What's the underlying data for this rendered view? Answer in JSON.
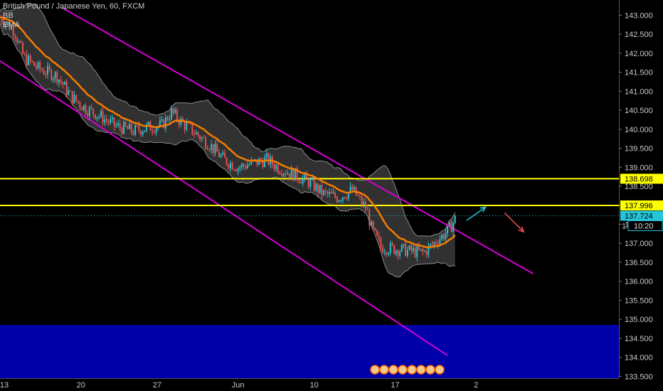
{
  "legend": {
    "symbol": "British Pound / Japanese Yen, 60, FXCM",
    "indicator_1": "BB",
    "indicator_2": "EMA"
  },
  "colors": {
    "background": "#000000",
    "candle_up": "#26c6da",
    "candle_down": "#ef5350",
    "ema": "#f57c00",
    "bb_fill": "#3a3a3a",
    "bb_line": "#8a8a8a",
    "channel": "#d400d4",
    "level": "#ffff00",
    "zone": "#0000a8",
    "price_tag": "#26c6da"
  },
  "chart_data": {
    "type": "candlestick",
    "title": "British Pound / Japanese Yen, 60, FXCM",
    "indicators": [
      "BB",
      "EMA"
    ],
    "ylim": [
      133.45,
      143.4
    ],
    "y_ticks": [
      "133.500",
      "134.000",
      "134.500",
      "135.000",
      "135.500",
      "136.000",
      "136.500",
      "137.000",
      "137.500",
      "138.000",
      "138.500",
      "139.000",
      "139.500",
      "140.000",
      "140.500",
      "141.000",
      "141.500",
      "142.000",
      "142.500",
      "143.000"
    ],
    "x_tick_labels": [
      "13",
      "20",
      "27",
      "Jun",
      "10",
      "17",
      "2"
    ],
    "horizontal_levels": [
      {
        "value": 138.698,
        "label": "138.698"
      },
      {
        "value": 137.996,
        "label": "137.996"
      }
    ],
    "current_price": {
      "value": 137.724,
      "label": "137.724",
      "countdown": "10:20",
      "partial_label": "1"
    },
    "support_zone": {
      "from": 133.45,
      "to": 134.85
    },
    "price_path": [
      {
        "t": 0,
        "p": 142.95
      },
      {
        "t": 3,
        "p": 142.6
      },
      {
        "t": 5,
        "p": 141.9
      },
      {
        "t": 8,
        "p": 141.6
      },
      {
        "t": 12,
        "p": 141.4
      },
      {
        "t": 15,
        "p": 140.85
      },
      {
        "t": 18,
        "p": 140.55
      },
      {
        "t": 21,
        "p": 140.35
      },
      {
        "t": 24,
        "p": 140.1
      },
      {
        "t": 28,
        "p": 139.95
      },
      {
        "t": 31,
        "p": 140.05
      },
      {
        "t": 34,
        "p": 140.1
      },
      {
        "t": 36,
        "p": 140.45
      },
      {
        "t": 38,
        "p": 140.2
      },
      {
        "t": 41,
        "p": 139.9
      },
      {
        "t": 44,
        "p": 139.6
      },
      {
        "t": 47,
        "p": 139.2
      },
      {
        "t": 50,
        "p": 139.0
      },
      {
        "t": 53,
        "p": 139.1
      },
      {
        "t": 56,
        "p": 139.2
      },
      {
        "t": 59,
        "p": 138.95
      },
      {
        "t": 62,
        "p": 138.8
      },
      {
        "t": 65,
        "p": 138.6
      },
      {
        "t": 68,
        "p": 138.3
      },
      {
        "t": 71,
        "p": 138.2
      },
      {
        "t": 74,
        "p": 138.4
      },
      {
        "t": 77,
        "p": 137.9
      },
      {
        "t": 78,
        "p": 137.4
      },
      {
        "t": 80,
        "p": 136.9
      },
      {
        "t": 83,
        "p": 136.85
      },
      {
        "t": 86,
        "p": 136.8
      },
      {
        "t": 89,
        "p": 136.75
      },
      {
        "t": 92,
        "p": 137.1
      },
      {
        "t": 94,
        "p": 137.3
      },
      {
        "t": 96,
        "p": 137.72
      }
    ],
    "channel_lines": [
      {
        "from": {
          "t": 13,
          "p": 143.2
        },
        "to": {
          "t": 112,
          "p": 136.2
        }
      },
      {
        "from": {
          "t": 0,
          "p": 141.8
        },
        "to": {
          "t": 94,
          "p": 134.05
        }
      }
    ],
    "projection_arrows": [
      {
        "direction": "up",
        "from": {
          "t": 98,
          "p": 137.6
        },
        "to": {
          "t": 102,
          "p": 137.95
        }
      },
      {
        "direction": "down",
        "from": {
          "t": 106,
          "p": 137.8
        },
        "to": {
          "t": 110,
          "p": 137.3
        }
      }
    ],
    "grid": false,
    "legend_position": "top-left"
  }
}
